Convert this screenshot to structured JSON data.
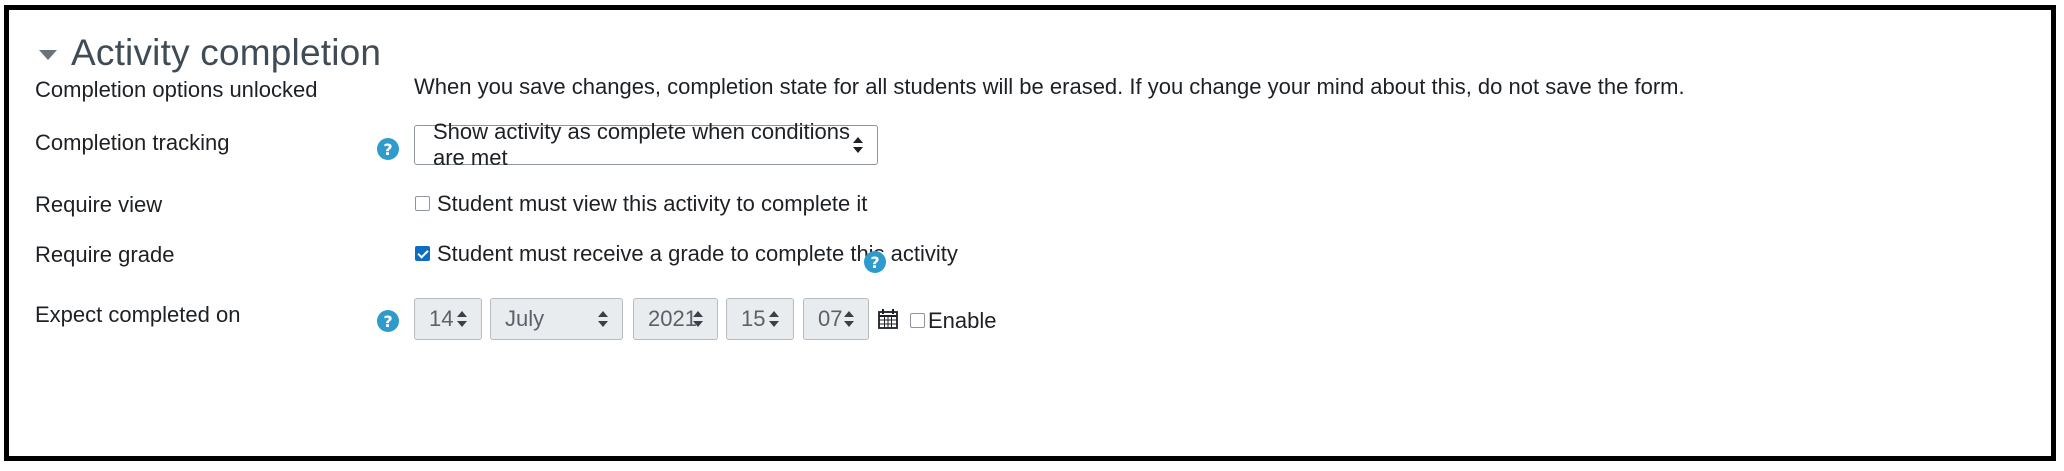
{
  "section": {
    "title": "Activity completion",
    "toggle_icon": "caret-down-icon"
  },
  "rows": {
    "unlocked": {
      "label": "Completion options unlocked",
      "notice": "When you save changes, completion state for all students will be erased. If you change your mind about this, do not save the form."
    },
    "tracking": {
      "label": "Completion tracking",
      "help_icon": "question-circle-icon",
      "help_glyph": "?",
      "selected": "Show activity as complete when conditions are met"
    },
    "require_view": {
      "label": "Require view",
      "checkbox_label": "Student must view this activity to complete it",
      "checked": false
    },
    "require_grade": {
      "label": "Require grade",
      "checkbox_label": "Student must receive a grade to complete this activity",
      "checked": true,
      "help_icon": "question-circle-icon",
      "help_glyph": "?"
    },
    "expect_completed": {
      "label": "Expect completed on",
      "help_icon": "question-circle-icon",
      "help_glyph": "?",
      "day": "14",
      "month": "July",
      "year": "2021",
      "hour": "15",
      "minute": "07",
      "calendar_icon": "calendar-icon",
      "enable_label": "Enable",
      "enabled": false
    }
  },
  "colors": {
    "help_icon": "#2f9bcc",
    "checkbox_checked": "#0f6cbf",
    "disabled_bg": "#e9ecef",
    "title": "#3f4b55"
  }
}
